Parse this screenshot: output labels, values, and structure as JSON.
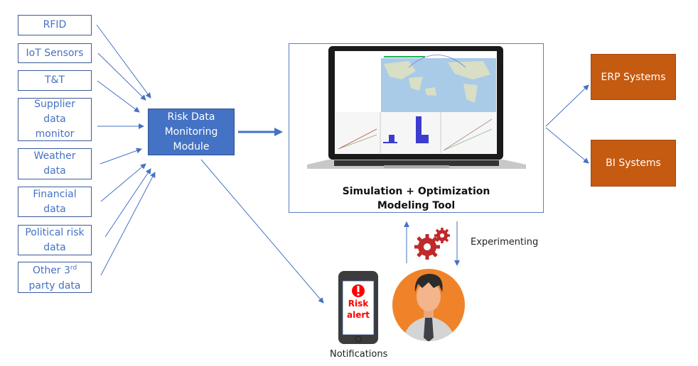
{
  "sources": [
    {
      "label": "RFID"
    },
    {
      "label": "IoT Sensors"
    },
    {
      "label": "T&T"
    },
    {
      "label": "Supplier data monitor"
    },
    {
      "label": "Weather data"
    },
    {
      "label": "Financial data"
    },
    {
      "label": "Political risk data"
    },
    {
      "label": "Other 3",
      "sup": "rd",
      "label2": "party data"
    }
  ],
  "risk_module": {
    "label": "Risk Data Monitoring Module"
  },
  "tool": {
    "line1": "Simulation + Optimization",
    "line2": "Modeling Tool"
  },
  "outputs": [
    {
      "label": "ERP Systems"
    },
    {
      "label": "BI Systems"
    }
  ],
  "phone": {
    "alert_line1": "Risk",
    "alert_line2": "alert",
    "icon": "exclamation-icon"
  },
  "notifications_label": "Notifications",
  "experimenting_label": "Experimenting",
  "colors": {
    "source_text": "#4472c4",
    "module": "#4472c4",
    "output": "#c55a11",
    "alert": "#ff0000",
    "avatar_bg": "#f0832a",
    "gear": "#c0282a"
  }
}
